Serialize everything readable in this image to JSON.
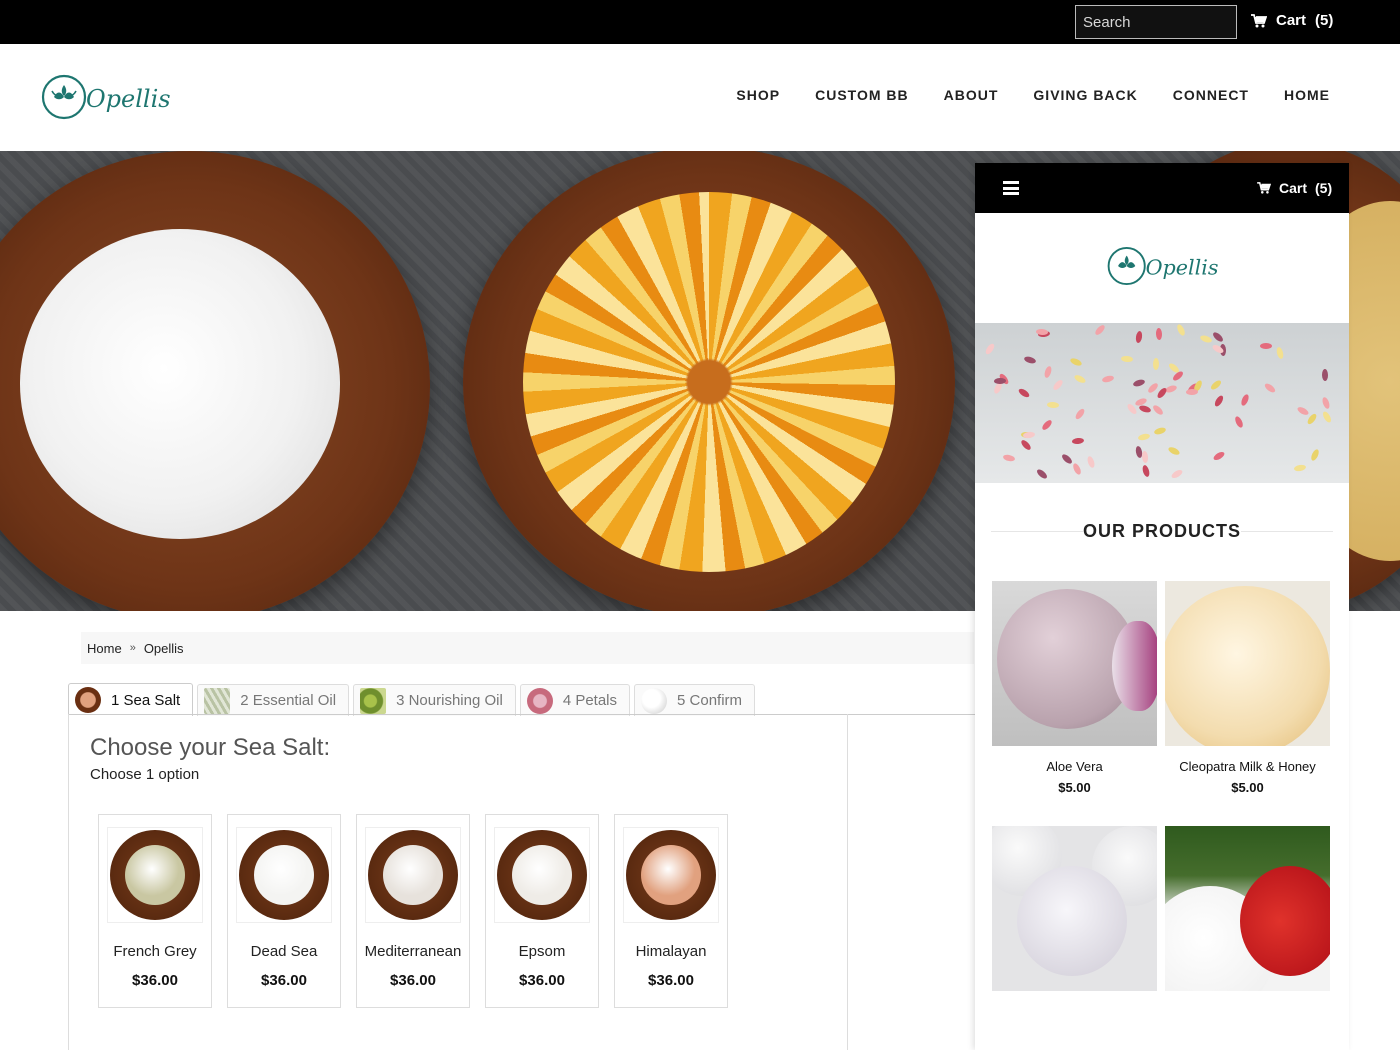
{
  "topbar": {
    "search_placeholder": "Search",
    "cart_label": "Cart",
    "cart_count": "(5)"
  },
  "header": {
    "brand": "Opellis",
    "nav": [
      {
        "label": "SHOP"
      },
      {
        "label": "CUSTOM BB"
      },
      {
        "label": "ABOUT"
      },
      {
        "label": "GIVING BACK"
      },
      {
        "label": "CONNECT"
      },
      {
        "label": "HOME"
      }
    ]
  },
  "breadcrumb": {
    "home": "Home",
    "separator": "»",
    "current": "Opellis"
  },
  "steps": [
    {
      "label": "1 Sea Salt",
      "active": true
    },
    {
      "label": "2 Essential Oil",
      "active": false
    },
    {
      "label": "3 Nourishing Oil",
      "active": false
    },
    {
      "label": "4 Petals",
      "active": false
    },
    {
      "label": "5 Confirm",
      "active": false
    }
  ],
  "choose": {
    "title": "Choose your Sea Salt:",
    "subtitle": "Choose 1 option"
  },
  "salts": [
    {
      "name": "French Grey",
      "price": "$36.00",
      "color": "#c9c7a2"
    },
    {
      "name": "Dead Sea",
      "price": "$36.00",
      "color": "#f4f4f2"
    },
    {
      "name": "Mediterranean",
      "price": "$36.00",
      "color": "#e7e2dc"
    },
    {
      "name": "Epsom",
      "price": "$36.00",
      "color": "#efece7"
    },
    {
      "name": "Himalayan",
      "price": "$36.00",
      "color": "#e1a17f"
    }
  ],
  "mobile": {
    "cart_label": "Cart",
    "cart_count": "(5)",
    "brand": "Opellis",
    "products_heading": "OUR PRODUCTS",
    "products": [
      {
        "name": "Aloe Vera",
        "price": "$5.00"
      },
      {
        "name": "Cleopatra Milk & Honey",
        "price": "$5.00"
      },
      {
        "name": "",
        "price": ""
      },
      {
        "name": "",
        "price": ""
      }
    ]
  },
  "colors": {
    "brand_teal": "#1e7670",
    "topbar": "#000000"
  }
}
